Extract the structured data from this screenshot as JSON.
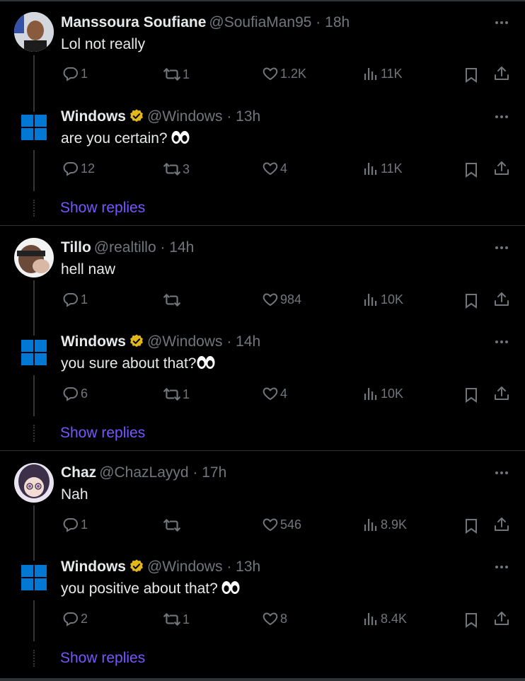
{
  "colors": {
    "background": "#000000",
    "text": "#e7e9ea",
    "muted": "#71767b",
    "link": "#7856ff",
    "verified": "#e2b719",
    "windows_blue": "#0078d4"
  },
  "threads": [
    {
      "reply": {
        "name": "Manssoura Soufiane",
        "handle": "@SoufiaMan95",
        "time": "18h",
        "text": "Lol not really",
        "replies": "1",
        "reposts": "1",
        "likes": "1.2K",
        "views": "11K"
      },
      "response": {
        "name": "Windows",
        "handle": "@Windows",
        "time": "13h",
        "text": "are you certain?",
        "replies": "12",
        "reposts": "3",
        "likes": "4",
        "views": "11K"
      },
      "show_replies": "Show replies"
    },
    {
      "reply": {
        "name": "Tillo",
        "handle": "@realtillo",
        "time": "14h",
        "text": "hell naw",
        "replies": "1",
        "reposts": "",
        "likes": "984",
        "views": "10K"
      },
      "response": {
        "name": "Windows",
        "handle": "@Windows",
        "time": "14h",
        "text": "you sure about that?",
        "replies": "6",
        "reposts": "1",
        "likes": "4",
        "views": "10K"
      },
      "show_replies": "Show replies"
    },
    {
      "reply": {
        "name": "Chaz",
        "handle": "@ChazLayyd",
        "time": "17h",
        "text": "Nah",
        "replies": "1",
        "reposts": "",
        "likes": "546",
        "views": "8.9K"
      },
      "response": {
        "name": "Windows",
        "handle": "@Windows",
        "time": "13h",
        "text": "you positive about that?",
        "replies": "2",
        "reposts": "1",
        "likes": "8",
        "views": "8.4K"
      },
      "show_replies": "Show replies"
    }
  ],
  "icons": [
    "reply-icon",
    "repost-icon",
    "like-icon",
    "views-icon",
    "bookmark-icon",
    "share-icon",
    "more-icon",
    "verified-badge-icon",
    "eyes-emoji-icon",
    "windows-logo-icon"
  ]
}
